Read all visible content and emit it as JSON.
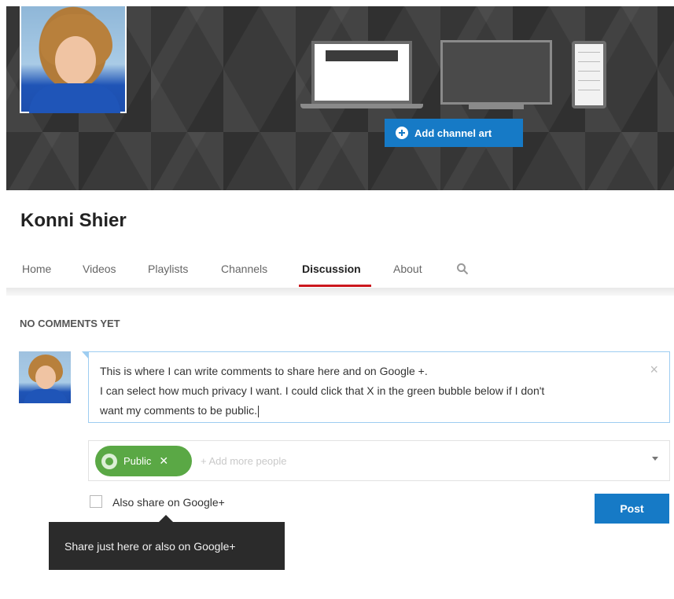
{
  "banner": {
    "add_channel_art_label": "Add channel art"
  },
  "channel": {
    "name": "Konni Shier"
  },
  "tabs": [
    {
      "label": "Home"
    },
    {
      "label": "Videos"
    },
    {
      "label": "Playlists"
    },
    {
      "label": "Channels"
    },
    {
      "label": "Discussion",
      "active": true
    },
    {
      "label": "About"
    }
  ],
  "discussion": {
    "heading": "NO COMMENTS YET",
    "comment_lines": [
      "This is where I can write comments to share here and on Google +.",
      "I can select how much privacy I want. I could click that X in the green bubble below if I don't",
      "want my comments to be public."
    ],
    "clear_symbol": "×",
    "share": {
      "chip_label": "Public",
      "chip_remove_symbol": "✕",
      "add_more_placeholder": "+ Add more people"
    },
    "also_share_label": "Also share on Google+",
    "post_label": "Post",
    "tooltip": "Share just here or also on Google+"
  },
  "colors": {
    "accent_blue": "#167ac6",
    "public_green": "#5aa845",
    "active_tab_underline": "#cc181e"
  }
}
